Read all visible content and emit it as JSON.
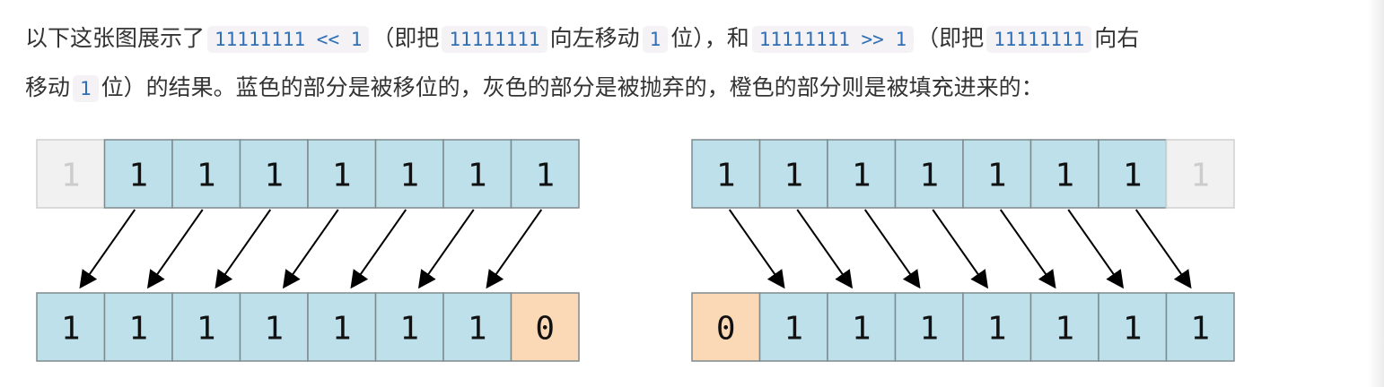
{
  "paragraph": {
    "t1": "以下这张图展示了",
    "c1": "11111111 << 1",
    "t2": "（即把",
    "c2": "11111111",
    "t3": "向左移动",
    "c3": "1",
    "t4": "位），和",
    "c4": "11111111 >> 1",
    "t5": "（即把",
    "c5": "11111111",
    "t6": "向右",
    "t7": "移动",
    "c6": "1",
    "t8": "位）的结果。蓝色的部分是被移位的，灰色的部分是被抛弃的，橙色的部分则是被填充进来的："
  },
  "colors": {
    "shifted": "#bde0eb",
    "discarded": "#f1f1f1",
    "filled": "#fcd9b6",
    "border": "#7f8a8d",
    "discarded_border": "#d0d0d0",
    "text": "#111111",
    "discarded_text": "#cccccc",
    "arrow": "#000000"
  },
  "left_shift": {
    "top": [
      {
        "v": "1",
        "kind": "discarded"
      },
      {
        "v": "1",
        "kind": "shifted"
      },
      {
        "v": "1",
        "kind": "shifted"
      },
      {
        "v": "1",
        "kind": "shifted"
      },
      {
        "v": "1",
        "kind": "shifted"
      },
      {
        "v": "1",
        "kind": "shifted"
      },
      {
        "v": "1",
        "kind": "shifted"
      },
      {
        "v": "1",
        "kind": "shifted"
      }
    ],
    "bottom": [
      {
        "v": "1",
        "kind": "shifted"
      },
      {
        "v": "1",
        "kind": "shifted"
      },
      {
        "v": "1",
        "kind": "shifted"
      },
      {
        "v": "1",
        "kind": "shifted"
      },
      {
        "v": "1",
        "kind": "shifted"
      },
      {
        "v": "1",
        "kind": "shifted"
      },
      {
        "v": "1",
        "kind": "shifted"
      },
      {
        "v": "0",
        "kind": "filled"
      }
    ]
  },
  "right_shift": {
    "top": [
      {
        "v": "1",
        "kind": "shifted"
      },
      {
        "v": "1",
        "kind": "shifted"
      },
      {
        "v": "1",
        "kind": "shifted"
      },
      {
        "v": "1",
        "kind": "shifted"
      },
      {
        "v": "1",
        "kind": "shifted"
      },
      {
        "v": "1",
        "kind": "shifted"
      },
      {
        "v": "1",
        "kind": "shifted"
      },
      {
        "v": "1",
        "kind": "discarded"
      }
    ],
    "bottom": [
      {
        "v": "0",
        "kind": "filled"
      },
      {
        "v": "1",
        "kind": "shifted"
      },
      {
        "v": "1",
        "kind": "shifted"
      },
      {
        "v": "1",
        "kind": "shifted"
      },
      {
        "v": "1",
        "kind": "shifted"
      },
      {
        "v": "1",
        "kind": "shifted"
      },
      {
        "v": "1",
        "kind": "shifted"
      },
      {
        "v": "1",
        "kind": "shifted"
      }
    ]
  }
}
